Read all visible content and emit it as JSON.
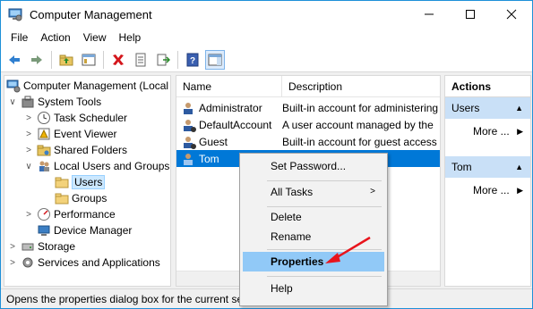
{
  "window": {
    "title": "Computer Management"
  },
  "menu": [
    "File",
    "Action",
    "View",
    "Help"
  ],
  "tree": [
    {
      "label": "Computer Management (Local",
      "exp": "",
      "level": 0
    },
    {
      "label": "System Tools",
      "exp": "∨",
      "level": 1
    },
    {
      "label": "Task Scheduler",
      "exp": ">",
      "level": 2
    },
    {
      "label": "Event Viewer",
      "exp": ">",
      "level": 2
    },
    {
      "label": "Shared Folders",
      "exp": ">",
      "level": 2
    },
    {
      "label": "Local Users and Groups",
      "exp": "∨",
      "level": 2
    },
    {
      "label": "Users",
      "exp": "",
      "level": 3
    },
    {
      "label": "Groups",
      "exp": "",
      "level": 3
    },
    {
      "label": "Performance",
      "exp": ">",
      "level": 2
    },
    {
      "label": "Device Manager",
      "exp": "",
      "level": 2
    },
    {
      "label": "Storage",
      "exp": ">",
      "level": 1
    },
    {
      "label": "Services and Applications",
      "exp": ">",
      "level": 1
    }
  ],
  "list": {
    "columns": [
      "Name",
      "Description"
    ],
    "rows": [
      {
        "name": "Administrator",
        "desc": "Built-in account for administering"
      },
      {
        "name": "DefaultAccount",
        "desc": "A user account managed by the"
      },
      {
        "name": "Guest",
        "desc": "Built-in account for guest access"
      },
      {
        "name": "Tom",
        "desc": ""
      }
    ]
  },
  "actions": {
    "header": "Actions",
    "sections": [
      {
        "title": "Users",
        "more": "More ..."
      },
      {
        "title": "Tom",
        "more": "More ..."
      }
    ]
  },
  "context_menu": {
    "items": [
      "Set Password...",
      "All Tasks",
      "Delete",
      "Rename",
      "Properties",
      "Help"
    ]
  },
  "status": "Opens the properties dialog box for the current selection.",
  "colors": {
    "selection": "#0078d7",
    "highlight": "#91c9f7",
    "arrow": "#e8141c"
  }
}
